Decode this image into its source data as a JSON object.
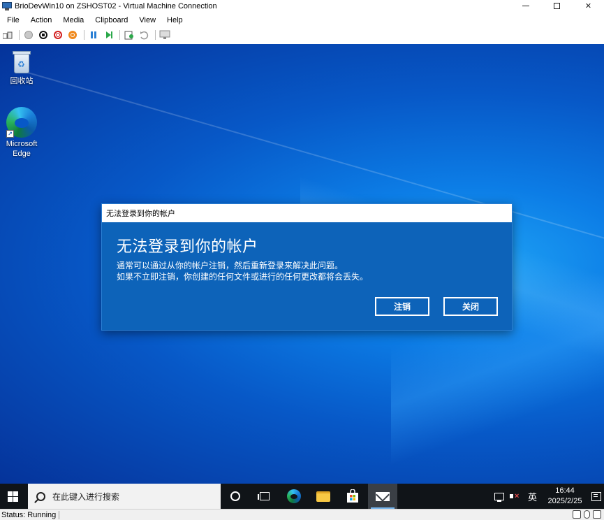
{
  "window": {
    "title": "BrioDevWin10 on ZSHOST02 - Virtual Machine Connection",
    "controls": {
      "minimize": "—",
      "maximize": "□",
      "close": "✕"
    }
  },
  "menu": {
    "items": [
      "File",
      "Action",
      "Media",
      "Clipboard",
      "View",
      "Help"
    ]
  },
  "toolbar": {
    "buttons": [
      "ctrl-alt-del-icon",
      "start-icon",
      "turn-off-icon",
      "shut-down-icon",
      "save-icon",
      "pause-icon",
      "resume-icon",
      "checkpoint-icon",
      "revert-icon",
      "enhanced-session-icon"
    ]
  },
  "desktop": {
    "icons": [
      {
        "label": "回收站",
        "icon": "recycle-bin-icon"
      },
      {
        "label": "Microsoft Edge",
        "icon": "edge-icon"
      }
    ]
  },
  "dialog": {
    "window_title": "无法登录到你的帐户",
    "heading": "无法登录到你的帐户",
    "message_line1": "通常可以通过从你的帐户注销，然后重新登录来解决此问题。",
    "message_line2": "如果不立即注销，你创建的任何文件或进行的任何更改都将会丢失。",
    "sign_out_button": "注销",
    "close_button": "关闭",
    "bg_color": "#0d63b9"
  },
  "taskbar": {
    "search_placeholder": "在此键入进行搜索",
    "apps": [
      "cortana-icon",
      "task-view-icon",
      "edge-icon",
      "file-explorer-icon",
      "store-icon",
      "mail-icon"
    ],
    "ime": "英",
    "time": "16:44",
    "date": "2025/2/25",
    "vol_mute_mark": "×"
  },
  "statusbar": {
    "status": "Status: Running"
  }
}
